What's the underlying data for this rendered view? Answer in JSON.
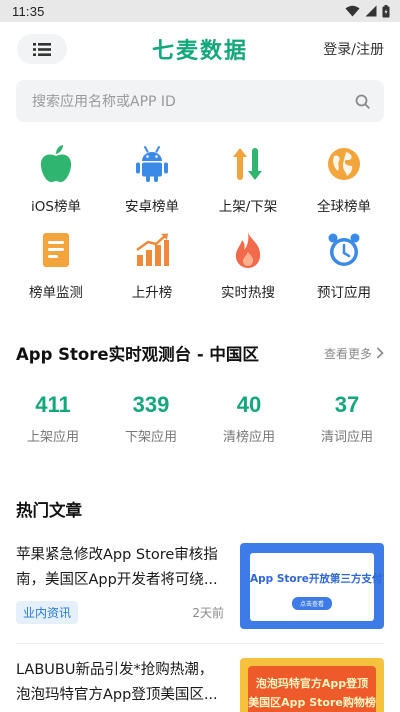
{
  "status_bar": {
    "time": "11:35"
  },
  "header": {
    "logo": "七麦数据",
    "login": "登录/注册"
  },
  "search": {
    "placeholder": "搜索应用名称或APP ID"
  },
  "quick_links": [
    {
      "label": "iOS榜单",
      "icon": "apple-icon",
      "color": "#2fb56f"
    },
    {
      "label": "安卓榜单",
      "icon": "android-icon",
      "color": "#3b8ae8"
    },
    {
      "label": "上架/下架",
      "icon": "up-down-arrows-icon",
      "color": "#f3a43b"
    },
    {
      "label": "全球榜单",
      "icon": "globe-icon",
      "color": "#f3a43b"
    },
    {
      "label": "榜单监测",
      "icon": "document-icon",
      "color": "#f3a43b"
    },
    {
      "label": "上升榜",
      "icon": "bar-chart-icon",
      "color": "#f08a3a"
    },
    {
      "label": "实时热搜",
      "icon": "flame-icon",
      "color": "#f26a4b"
    },
    {
      "label": "预订应用",
      "icon": "alarm-clock-icon",
      "color": "#3b8ae8"
    }
  ],
  "observe": {
    "title": "App Store实时观测台 - 中国区",
    "more": "查看更多",
    "stats": [
      {
        "value": "411",
        "label": "上架应用"
      },
      {
        "value": "339",
        "label": "下架应用"
      },
      {
        "value": "40",
        "label": "清榜应用"
      },
      {
        "value": "37",
        "label": "清词应用"
      }
    ]
  },
  "hot_articles": {
    "title": "热门文章",
    "items": [
      {
        "title": "苹果紧急修改App Store审核指南，美国区App开发者将可绕...",
        "tag": "业内资讯",
        "time": "2天前",
        "thumb_text": "App Store开放第三方支付?",
        "thumb_button": "点击查看"
      },
      {
        "title": "LABUBU新品引发*抢购热潮，泡泡玛特官方App登顶美国区...",
        "thumb_line1": "泡泡玛特官方App登顶",
        "thumb_line2": "美国区App Store购物榜"
      }
    ]
  },
  "colors": {
    "brand": "#12a87c",
    "tag_bg": "#e6f0fb",
    "tag_fg": "#2a7ad6"
  }
}
